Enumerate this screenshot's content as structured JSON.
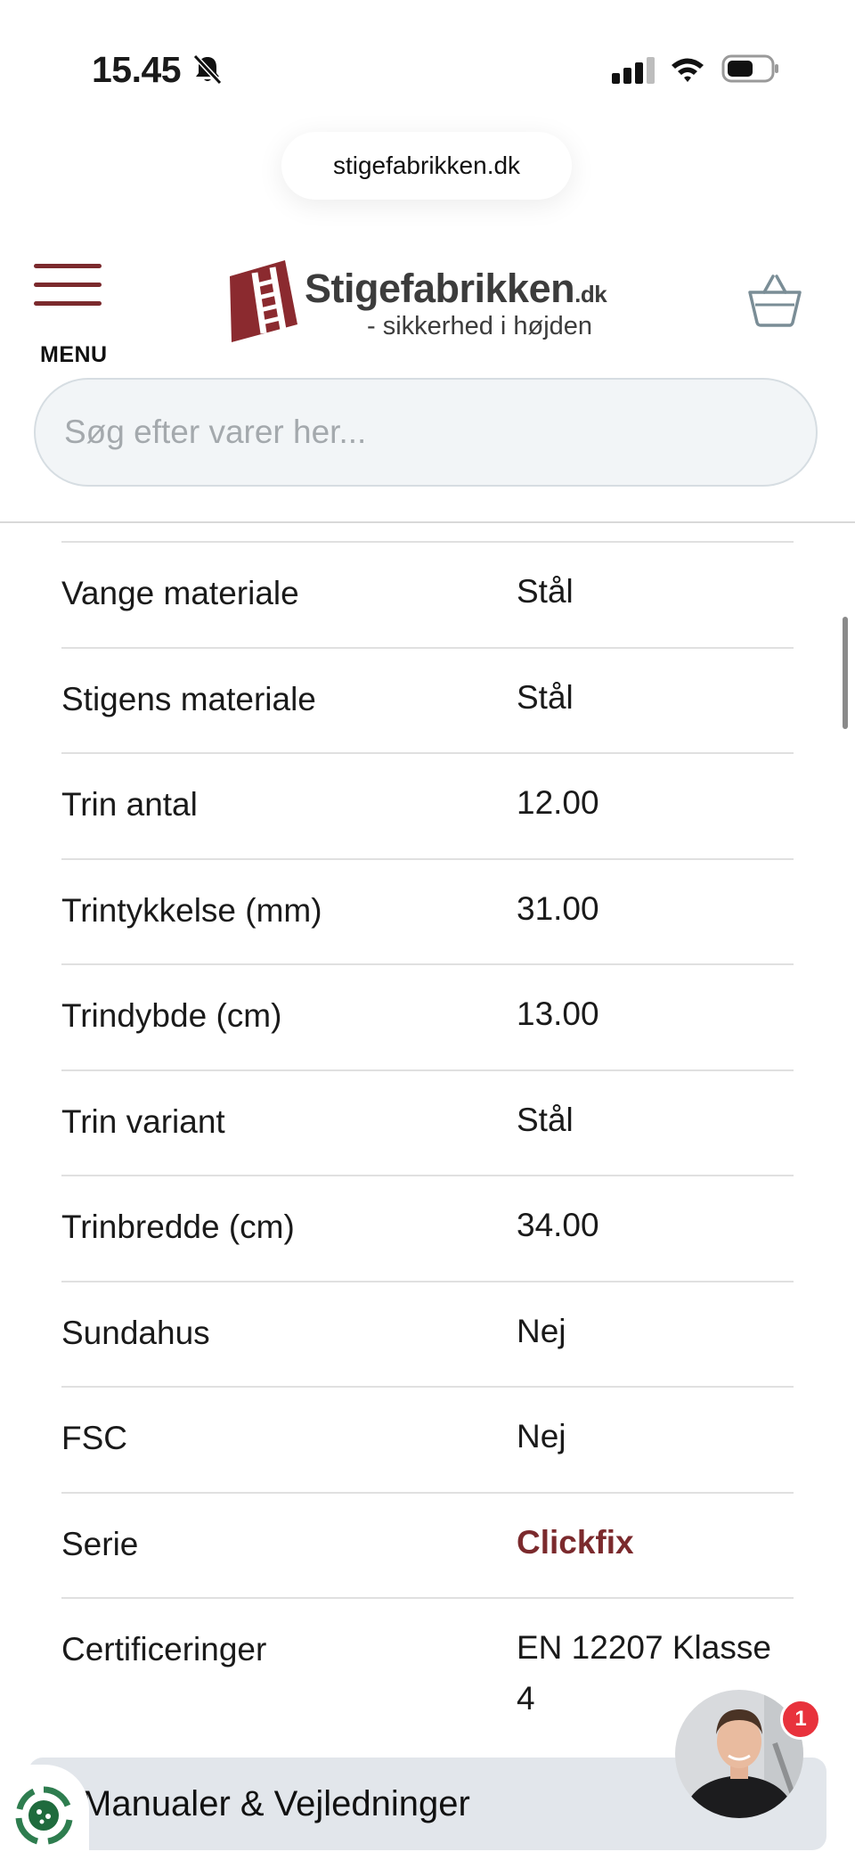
{
  "status_bar": {
    "time": "15.45"
  },
  "browser": {
    "url": "stigefabrikken.dk"
  },
  "header": {
    "menu_label": "MENU",
    "logo_name": "Stigefabrikken",
    "logo_tld": ".dk",
    "logo_tagline": "- sikkerhed i højden"
  },
  "search": {
    "placeholder": "Søg efter varer her..."
  },
  "specs": [
    {
      "key": "Vange materiale",
      "value": "Stål"
    },
    {
      "key": "Stigens materiale",
      "value": "Stål"
    },
    {
      "key": "Trin antal",
      "value": "12.00"
    },
    {
      "key": "Trintykkelse (mm)",
      "value": "31.00"
    },
    {
      "key": "Trindybde (cm)",
      "value": "13.00"
    },
    {
      "key": "Trin variant",
      "value": "Stål"
    },
    {
      "key": "Trinbredde (cm)",
      "value": "34.00"
    },
    {
      "key": "Sundahus",
      "value": "Nej"
    },
    {
      "key": "FSC",
      "value": "Nej"
    },
    {
      "key": "Serie",
      "value": "Clickfix"
    },
    {
      "key": "Certificeringer",
      "value": "EN 12207 Klasse 4"
    }
  ],
  "manuals": {
    "label": "Manualer & Vejledninger"
  },
  "chat": {
    "badge_count": "1"
  },
  "colors": {
    "brand": "#7b2a2d",
    "badge": "#e8323c"
  },
  "icons": [
    "bell-slash-icon",
    "cellular-signal-icon",
    "wifi-icon",
    "battery-icon",
    "hamburger-menu-icon",
    "logo-ladder-icon",
    "basket-icon",
    "cookie-consent-icon"
  ]
}
